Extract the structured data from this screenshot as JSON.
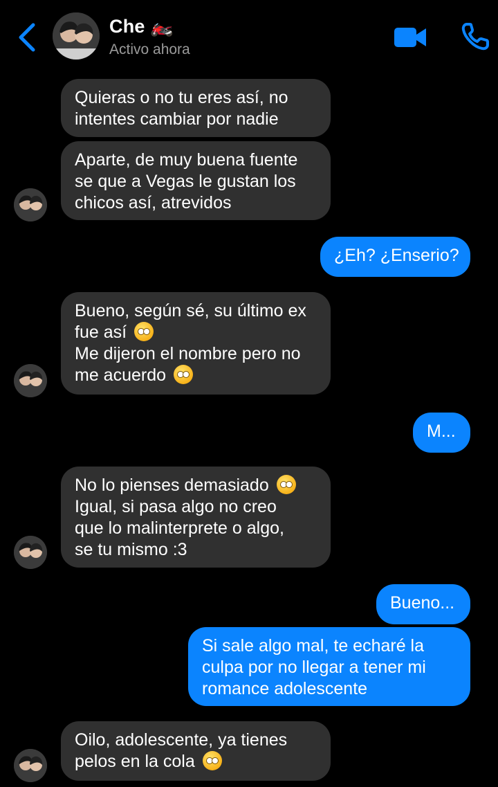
{
  "header": {
    "contact_name": "Che 🏍️",
    "status": "Activo ahora"
  },
  "colors": {
    "accent": "#0b84fe",
    "incoming_bubble": "#303030",
    "background": "#000000"
  },
  "messages": {
    "m1": {
      "lines": [
        "Quieras o no tu eres así, no",
        "intentes cambiar por nadie"
      ]
    },
    "m2": {
      "lines": [
        "Aparte, de muy buena fuente",
        "se que a Vegas le gustan los",
        "chicos así, atrevidos"
      ]
    },
    "m3": {
      "lines": [
        "¿Eh? ¿Enserio?"
      ]
    },
    "m4": {
      "lines": [
        "Bueno, según sé, su último ex",
        "fue así",
        "Me dijeron el nombre pero no",
        "me acuerdo"
      ]
    },
    "m5": {
      "lines": [
        "M..."
      ]
    },
    "m6": {
      "lines": [
        "No lo pienses demasiado",
        "Igual, si pasa algo no creo",
        "que lo malinterprete o algo,",
        "se tu mismo :3"
      ]
    },
    "m7": {
      "lines": [
        "Bueno..."
      ]
    },
    "m8": {
      "lines": [
        "Si sale algo mal, te echaré la",
        "culpa por no llegar a tener mi",
        "romance adolescente"
      ]
    },
    "m9": {
      "lines": [
        "Oilo, adolescente, ya tienes",
        "pelos en la cola"
      ]
    }
  },
  "icons": [
    "back-chevron-icon",
    "video-call-icon",
    "phone-call-icon",
    "thinking-emoji",
    "smiling-tear-emoji",
    "eye-roll-emoji"
  ]
}
